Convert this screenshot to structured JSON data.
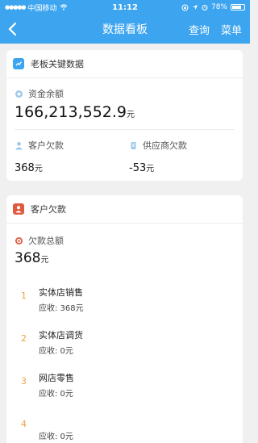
{
  "status_bar": {
    "carrier": "中国移动",
    "time": "11:12",
    "battery_text": "78%",
    "battery_level": 0.78
  },
  "nav": {
    "title": "数据看板",
    "query_label": "查询",
    "menu_label": "菜单"
  },
  "key_data": {
    "title": "老板关键数据",
    "balance_label": "资金余额",
    "balance_value": "166,213,552.9",
    "balance_unit": "元",
    "customer_debt_label": "客户欠款",
    "customer_debt_value": "368",
    "customer_debt_unit": "元",
    "supplier_debt_label": "供应商欠款",
    "supplier_debt_value": "-53",
    "supplier_debt_unit": "元"
  },
  "customer_debt": {
    "title": "客户欠款",
    "total_label": "欠款总额",
    "total_value": "368",
    "total_unit": "元",
    "items": [
      {
        "index": "1",
        "name": "实体店销售",
        "due": "应收: 368元"
      },
      {
        "index": "2",
        "name": "实体店调货",
        "due": "应收: 0元"
      },
      {
        "index": "3",
        "name": "网店零售",
        "due": "应收: 0元"
      },
      {
        "index": "4",
        "name": "",
        "due": "应收: 0元"
      }
    ]
  },
  "colors": {
    "accent": "#3da5f0",
    "index": "#f0a040",
    "card2_icon": "#e05a40"
  }
}
